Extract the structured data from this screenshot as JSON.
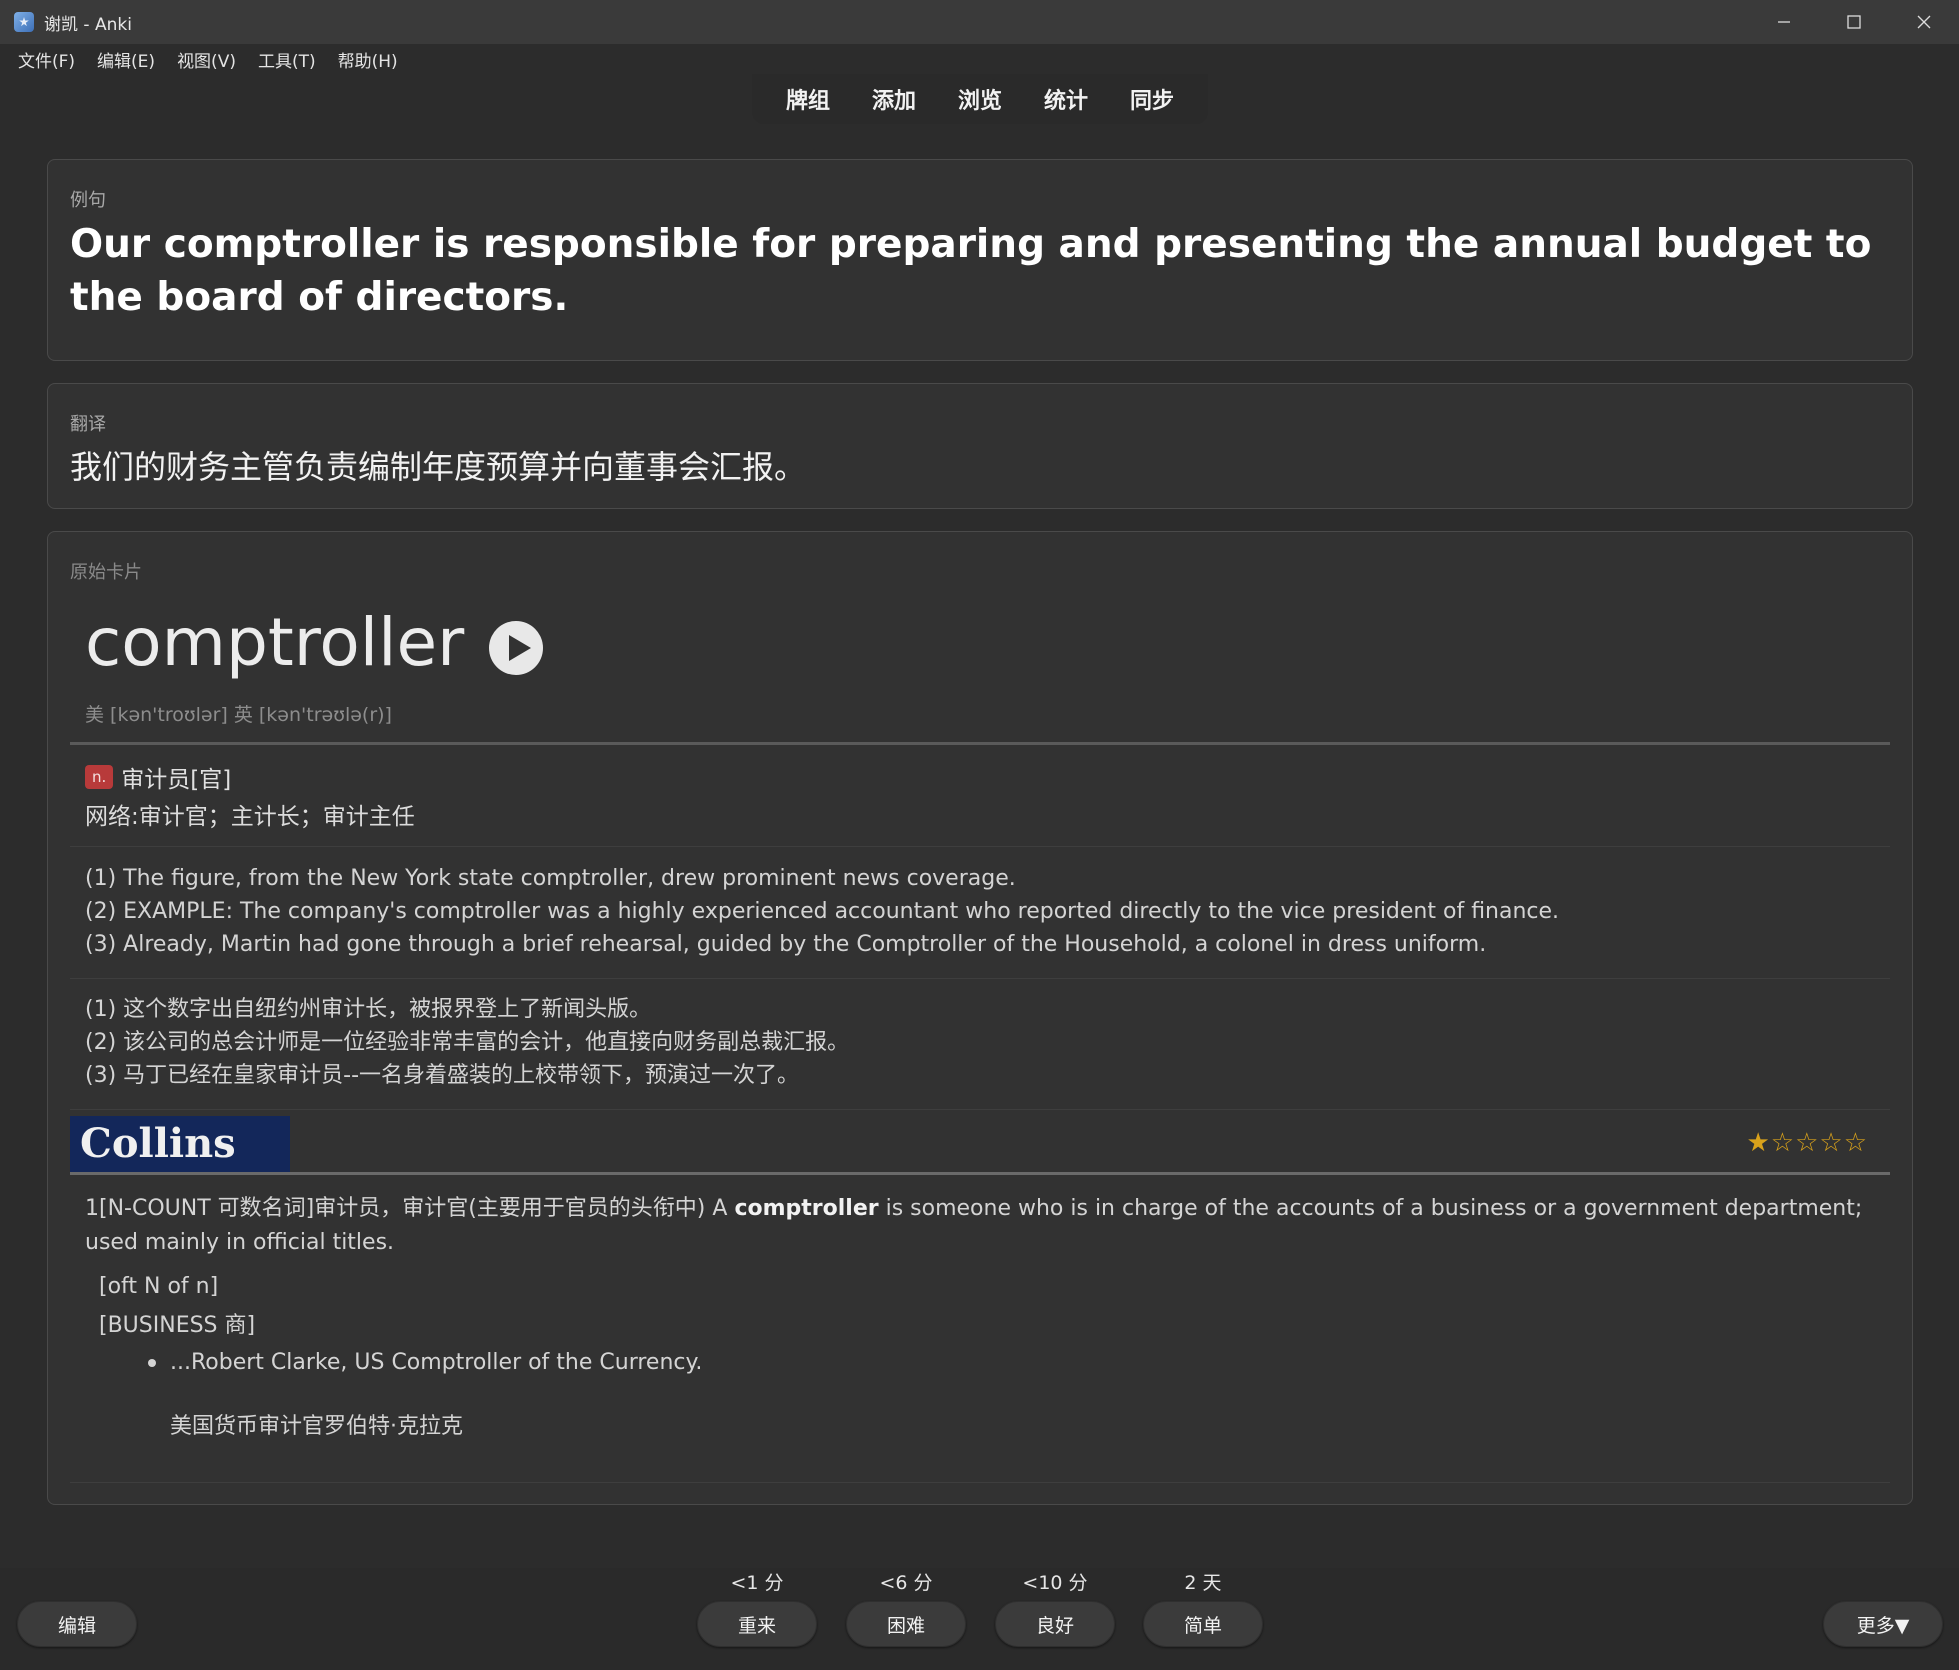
{
  "window": {
    "title": "谢凯 - Anki",
    "controls": [
      "minimize-icon",
      "maximize-icon",
      "close-icon"
    ]
  },
  "menu": [
    "文件(F)",
    "编辑(E)",
    "视图(V)",
    "工具(T)",
    "帮助(H)"
  ],
  "toolbar": [
    "牌组",
    "添加",
    "浏览",
    "统计",
    "同步"
  ],
  "card": {
    "sentence_label": "例句",
    "sentence": "Our comptroller is responsible for preparing and presenting the annual budget to the board of directors.",
    "translation_label": "翻译",
    "translation": "我们的财务主管负责编制年度预算并向董事会汇报。",
    "original_label": "原始卡片",
    "word": "comptroller",
    "phonetic": "美 [kən'troʊlər]  英 [kən'trəʊlə(r)]",
    "pos": "n.",
    "pos_def": "审计员[官]",
    "net_def": "网络:审计官；主计长；审计主任",
    "examples_en": [
      "(1) The figure, from the New York state comptroller, drew prominent news coverage.",
      "(2) EXAMPLE: The company's comptroller was a highly experienced accountant who reported directly to the vice president of finance.",
      "(3) Already, Martin had gone through a brief rehearsal, guided by the Comptroller of the Household, a colonel in dress uniform."
    ],
    "examples_zh": [
      "(1) 这个数字出自纽约州审计长，被报界登上了新闻头版。",
      "(2) 该公司的总会计师是一位经验非常丰富的会计，他直接向财务副总裁汇报。",
      "(3) 马丁已经在皇家审计员--一名身着盛装的上校带领下，预演过一次了。"
    ],
    "collins": {
      "logo": "Collins",
      "stars": "★☆☆☆☆",
      "rating": 1,
      "def_prefix": "1[N-COUNT 可数名词]审计员，审计官(主要用于官员的头衔中) A ",
      "def_bold": "comptroller",
      "def_suffix": " is someone who is in charge of the accounts of a business or a government department; used mainly in official titles.",
      "gram1": "[oft N of n]",
      "gram2": "[BUSINESS 商]",
      "example": "...Robert Clarke, US Comptroller of the Currency.",
      "example_trans": "美国货币审计官罗伯特·克拉克"
    }
  },
  "bottom": {
    "edit": "编辑",
    "more": "更多▼",
    "answers": [
      {
        "due": "<1 分",
        "label": "重来"
      },
      {
        "due": "<6 分",
        "label": "困难"
      },
      {
        "due": "<10 分",
        "label": "良好"
      },
      {
        "due": "2 天",
        "label": "简单"
      }
    ]
  },
  "colors": {
    "background": "#2c2c2c",
    "panel": "#323232",
    "pos_badge": "#b83a3a",
    "collins_logo": "#13275a",
    "stars": "#d9a21b"
  }
}
